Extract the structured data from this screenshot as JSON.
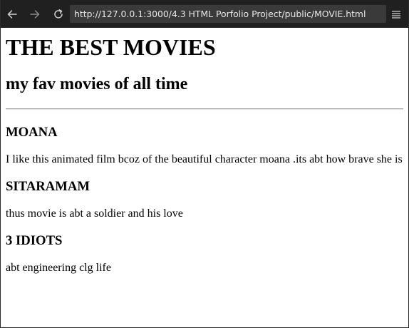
{
  "browser": {
    "url": "http://127.0.0.1:3000/4.3 HTML Porfolio Project/public/MOVIE.html",
    "icons": {
      "back": "back-arrow-icon",
      "forward": "forward-arrow-icon",
      "reload": "reload-icon",
      "menu": "hamburger-menu-icon"
    },
    "colors": {
      "toolbar_bg": "#202020",
      "address_bg": "#3a3a3a",
      "icon_color": "#d0d0d0",
      "icon_disabled": "#8a8a8a"
    }
  },
  "page": {
    "title": "THE BEST MOVIES",
    "subtitle": "my fav movies of all time",
    "movies": [
      {
        "title": "MOANA",
        "description": "I like this animated film bcoz of the beautiful character moana .its abt how brave she is"
      },
      {
        "title": "SITARAMAM",
        "description": "thus movie is abt a soldier and his love"
      },
      {
        "title": "3 IDIOTS",
        "description": "abt engineering clg life"
      }
    ]
  }
}
